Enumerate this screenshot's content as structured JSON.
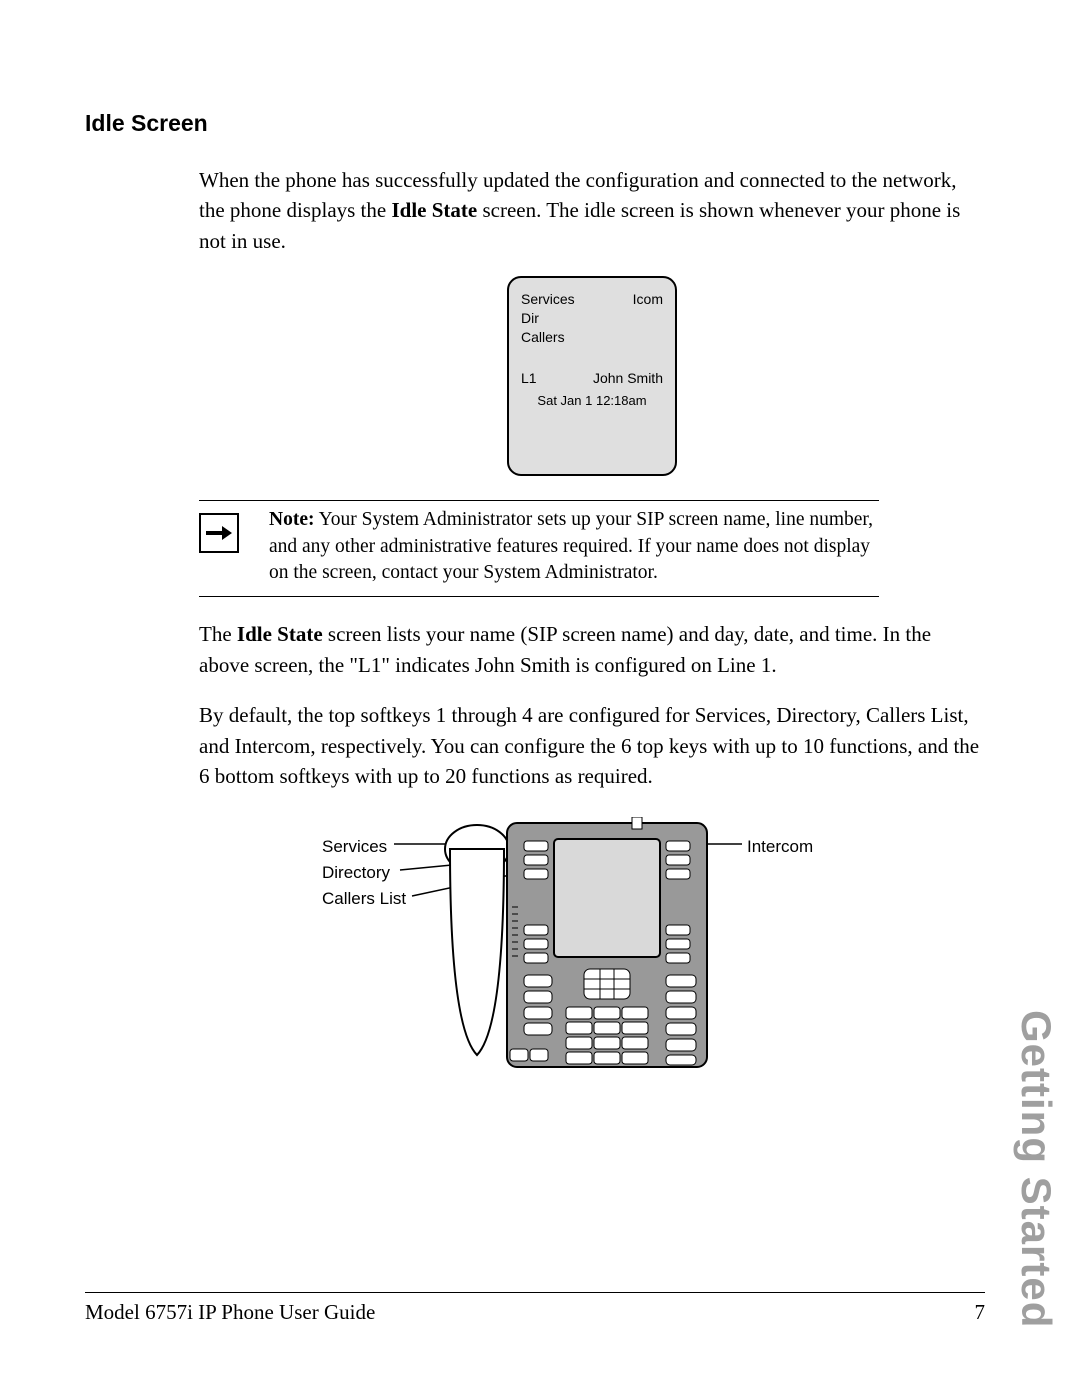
{
  "heading": "Idle Screen",
  "para1_a": "When the phone has successfully updated the configuration and connected to the network, the phone displays the ",
  "para1_bold": "Idle State",
  "para1_b": " screen. The idle screen is shown whenever your phone is not in use.",
  "lcd": {
    "services": "Services",
    "icom": "Icom",
    "dir": "Dir",
    "callers": "Callers",
    "line": "L1",
    "name": "John Smith",
    "datetime": "Sat  Jan 1  12:18am"
  },
  "note_label": "Note:",
  "note_text": " Your System Administrator sets up your SIP screen name, line number, and any other administrative features required. If your name does not display on the screen, contact your System Administrator.",
  "para2_a": "The ",
  "para2_bold": "Idle State",
  "para2_b": " screen lists your name (SIP screen name) and day, date, and time. In the above screen, the \"L1\" indicates John Smith is configured on Line 1.",
  "para3": "By default, the top softkeys 1 through 4 are configured for Services, Directory, Callers List, and Intercom, respectively. You can configure the 6 top keys with up to 10 functions, and the 6 bottom softkeys with up to 20 functions as required.",
  "labels": {
    "services": "Services",
    "directory": "Directory",
    "callers": "Callers List",
    "intercom": "Intercom"
  },
  "footer_left": "Model 6757i IP Phone User Guide",
  "footer_right": "7",
  "chapter": "Getting Started"
}
